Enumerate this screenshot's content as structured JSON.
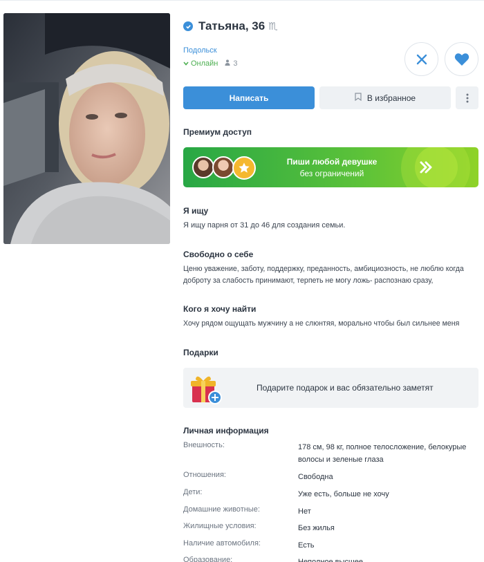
{
  "profile": {
    "name": "Татьяна, 36",
    "zodiac": "♏",
    "city": "Подольск",
    "online": "Онлайн",
    "photos_count": "3"
  },
  "actions": {
    "write": "Написать",
    "favorite": "В избранное"
  },
  "premium": {
    "title": "Премиум доступ",
    "line1": "Пиши любой девушке",
    "line2": "без ограничений"
  },
  "seeking": {
    "title": "Я ищу",
    "text": "Я ищу парня от 31 до 46 для создания семьи."
  },
  "about": {
    "title": "Свободно о себе",
    "text": "Ценю уважение, заботу, поддержку, преданность, амбициозность, не люблю когда доброту за слабость принимают, терпеть не могу ложь- распознаю сразу,"
  },
  "want": {
    "title": "Кого я хочу найти",
    "text": "Хочу рядом ощущать мужчину а не слюнтяя, морально чтобы был сильнее меня"
  },
  "gifts": {
    "title": "Подарки",
    "text": "Подарите подарок и вас обязательно заметят"
  },
  "personal": {
    "title": "Личная информация",
    "rows": [
      {
        "label": "Внешность:",
        "value": "178 см, 98 кг, полное телосложение, белокурые волосы и зеленые глаза"
      },
      {
        "label": "Отношения:",
        "value": "Свободна"
      },
      {
        "label": "Дети:",
        "value": "Уже есть, больше не хочу"
      },
      {
        "label": "Домашние животные:",
        "value": "Нет"
      },
      {
        "label": "Жилищные условия:",
        "value": "Без жилья"
      },
      {
        "label": "Наличие автомобиля:",
        "value": "Есть"
      },
      {
        "label": "Образование:",
        "value": "Неполное высшее"
      }
    ]
  },
  "colors": {
    "accent": "#3b8fd9",
    "online": "#4caf50",
    "premium_start": "#28a745",
    "premium_end": "#8fd228"
  }
}
